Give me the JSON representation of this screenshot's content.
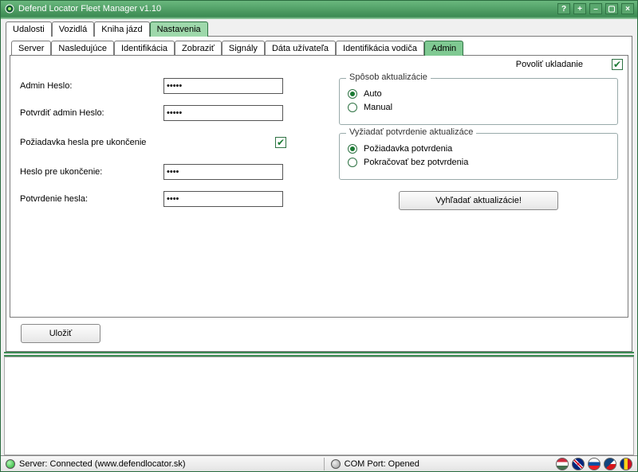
{
  "window": {
    "title": "Defend Locator Fleet Manager v1.10"
  },
  "outer_tabs": [
    "Udalosti",
    "Vozidlá",
    "Kniha jázd",
    "Nastavenia"
  ],
  "outer_active_index": 3,
  "inner_tabs": [
    "Server",
    "Nasledujúce",
    "Identifikácia",
    "Zobraziť",
    "Signály",
    "Dáta užívateľa",
    "Identifikácia vodiča",
    "Admin"
  ],
  "inner_active_index": 7,
  "allow_save_label": "Povoliť ukladanie",
  "allow_save_checked": true,
  "left": {
    "admin_pw_label": "Admin Heslo:",
    "admin_pw_value": "xxxxx",
    "admin_pw_confirm_label": "Potvrdiť admin Heslo:",
    "admin_pw_confirm_value": "xxxxx",
    "require_exit_pw_label": "Požiadavka hesla pre ukončenie",
    "require_exit_pw_checked": true,
    "exit_pw_label": "Heslo pre ukončenie:",
    "exit_pw_value": "xxxx",
    "exit_pw_confirm_label": "Potvrdenie hesla:",
    "exit_pw_confirm_value": "xxxx"
  },
  "update_mode": {
    "legend": "Spôsob aktualizácie",
    "options": [
      "Auto",
      "Manual"
    ],
    "selected_index": 0
  },
  "update_confirm": {
    "legend": "Vyžiadať potvrdenie aktualizáce",
    "options": [
      "Požiadavka potvrdenia",
      "Pokračovať bez potvrdenia"
    ],
    "selected_index": 0
  },
  "buttons": {
    "search_updates": "Vyhľadať aktualizácie!",
    "save": "Uložiť"
  },
  "status": {
    "server": "Server: Connected (www.defendlocator.sk)",
    "com": "COM Port: Opened"
  },
  "flags": [
    "hu",
    "gb",
    "sk",
    "cz",
    "ro"
  ]
}
